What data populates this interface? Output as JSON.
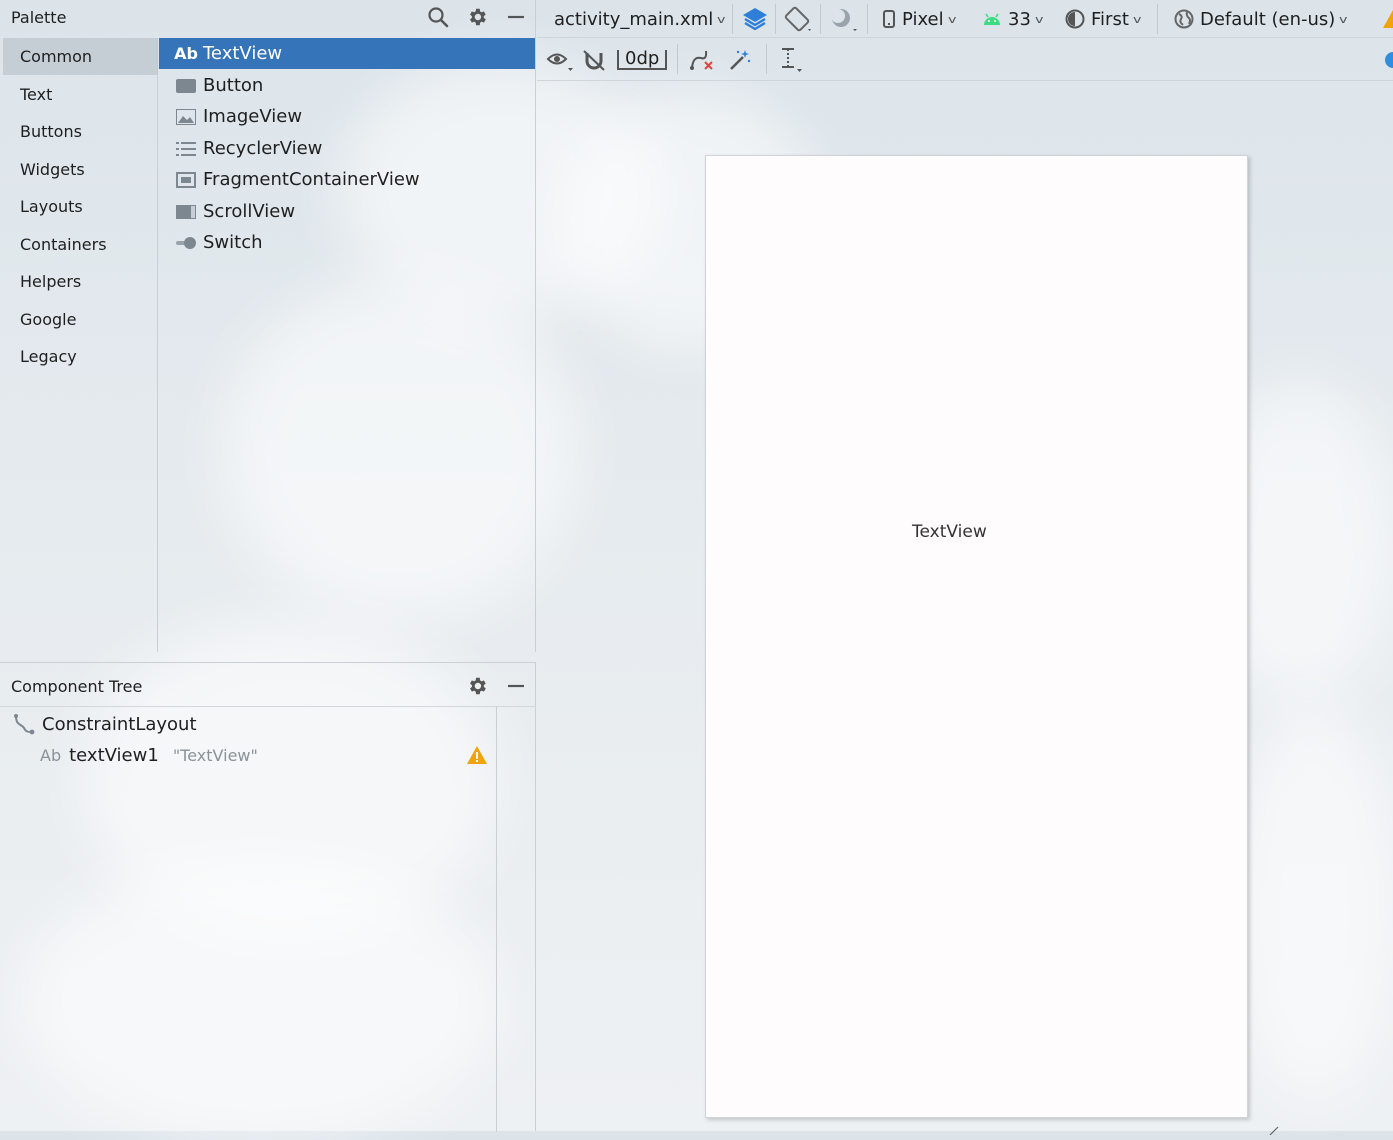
{
  "palette": {
    "title": "Palette",
    "header_icons": [
      "search-icon",
      "gear-icon",
      "minimize-icon"
    ],
    "categories": [
      {
        "label": "Common",
        "selected": true
      },
      {
        "label": "Text"
      },
      {
        "label": "Buttons"
      },
      {
        "label": "Widgets"
      },
      {
        "label": "Layouts"
      },
      {
        "label": "Containers"
      },
      {
        "label": "Helpers"
      },
      {
        "label": "Google"
      },
      {
        "label": "Legacy"
      }
    ],
    "widgets": [
      {
        "label": "TextView",
        "icon": "textview-icon",
        "icon_text": "Ab",
        "selected": true
      },
      {
        "label": "Button",
        "icon": "button-icon"
      },
      {
        "label": "ImageView",
        "icon": "imageview-icon"
      },
      {
        "label": "RecyclerView",
        "icon": "recyclerview-icon"
      },
      {
        "label": "FragmentContainerView",
        "icon": "fragment-container-icon"
      },
      {
        "label": "ScrollView",
        "icon": "scrollview-icon"
      },
      {
        "label": "Switch",
        "icon": "switch-icon"
      }
    ]
  },
  "component_tree": {
    "title": "Component Tree",
    "root": {
      "label": "ConstraintLayout",
      "icon": "constraint-layout-icon"
    },
    "child": {
      "icon_text": "Ab",
      "label": "textView1",
      "value": "\"TextView\"",
      "warning": true
    }
  },
  "toolbar": {
    "file": "activity_main.xml",
    "device": "Pixel",
    "api": "33",
    "theme": "First",
    "locale": "Default (en-us)",
    "margin": "0dp"
  },
  "canvas": {
    "textview_text": "TextView"
  },
  "colors": {
    "selection": "#3574b9",
    "warning": "#f0a30a",
    "android_green": "#3ddc84",
    "layers_blue": "#2f7fd8"
  }
}
